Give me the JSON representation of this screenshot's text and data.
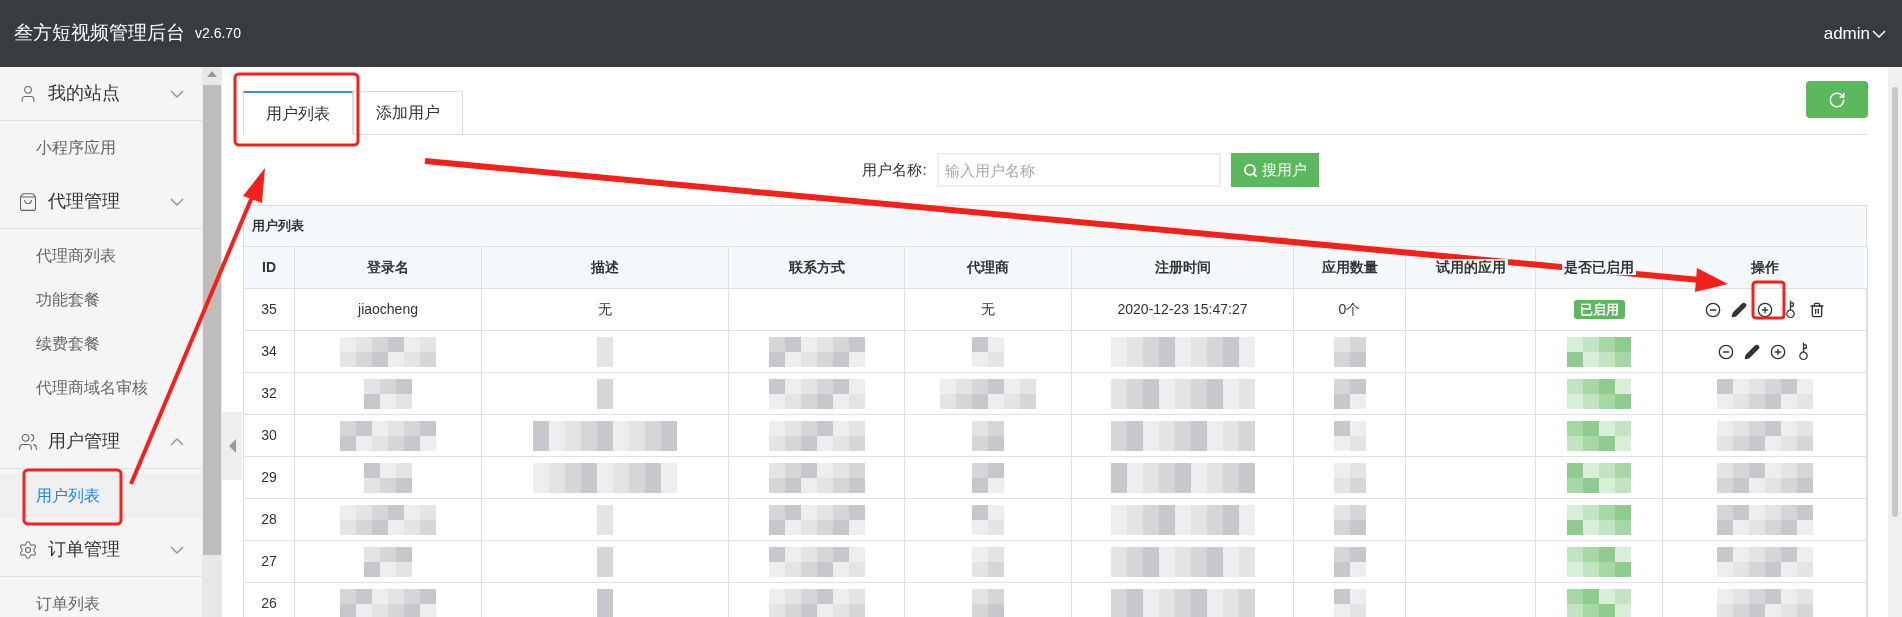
{
  "header": {
    "title": "叁方短视频管理后台",
    "version": "v2.6.70",
    "user": "admin"
  },
  "sidebar": [
    {
      "label": "我的站点",
      "expanded": false,
      "children": [
        {
          "label": "小程序应用",
          "selected": false
        }
      ]
    },
    {
      "label": "代理管理",
      "expanded": false,
      "children": [
        {
          "label": "代理商列表",
          "selected": false
        },
        {
          "label": "功能套餐",
          "selected": false
        },
        {
          "label": "续费套餐",
          "selected": false
        },
        {
          "label": "代理商域名审核",
          "selected": false
        }
      ]
    },
    {
      "label": "用户管理",
      "expanded": true,
      "children": [
        {
          "label": "用户列表",
          "selected": true
        }
      ]
    },
    {
      "label": "订单管理",
      "expanded": false,
      "children": [
        {
          "label": "订单列表",
          "selected": false
        }
      ]
    }
  ],
  "tabs": [
    {
      "label": "用户列表",
      "selected": true
    },
    {
      "label": "添加用户",
      "selected": false
    }
  ],
  "search": {
    "label": "用户名称:",
    "placeholder": "输入用户名称",
    "button": "搜用户"
  },
  "table": {
    "title": "用户列表",
    "columns": [
      "ID",
      "登录名",
      "描述",
      "联系方式",
      "代理商",
      "注册时间",
      "应用数量",
      "试用的应用",
      "是否已启用",
      "操作"
    ],
    "rows": [
      {
        "kind": "plain",
        "id": "35",
        "login": "jiaocheng",
        "desc": "无",
        "agent": "无",
        "registered": "2020-12-23 15:47:27",
        "apps": "0个",
        "status": "已启用"
      },
      {
        "kind": "pixelated_with_actions",
        "id": "34"
      },
      {
        "kind": "pixelated",
        "id": "32"
      },
      {
        "kind": "pixelated",
        "id": "30"
      },
      {
        "kind": "pixelated",
        "id": "29"
      },
      {
        "kind": "pixelated",
        "id": "28"
      },
      {
        "kind": "pixelated",
        "id": "27"
      },
      {
        "kind": "pixelated",
        "id": "26"
      }
    ]
  }
}
